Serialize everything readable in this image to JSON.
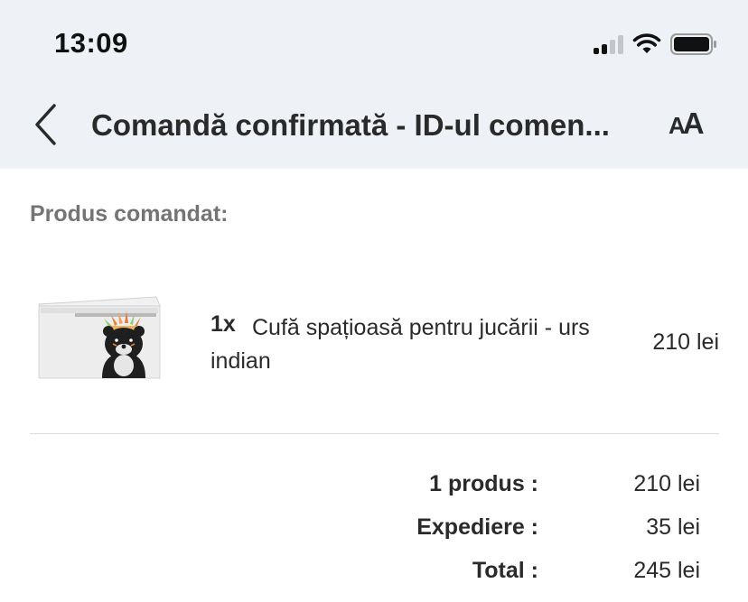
{
  "status_bar": {
    "time": "13:09",
    "icons": [
      "signal-icon",
      "wifi-icon",
      "battery-icon"
    ]
  },
  "nav": {
    "back_icon": "chevron-left-icon",
    "title": "Comandă confirmată - ID-ul comen...",
    "text_size_small": "A",
    "text_size_big": "A"
  },
  "order": {
    "section_title": "Produs comandat:",
    "items": [
      {
        "quantity": "1x",
        "name": "Cufă spațioasă pentru jucării - urs indian",
        "price": "210 lei"
      }
    ],
    "summary": [
      {
        "label": "1 produs :",
        "value": "210 lei"
      },
      {
        "label": "Expediere :",
        "value": "35 lei"
      },
      {
        "label": "Total :",
        "value": "245 lei"
      }
    ]
  },
  "colors": {
    "header_bg": "#eef1f5",
    "text": "#2a2a2a",
    "muted": "#747474"
  }
}
